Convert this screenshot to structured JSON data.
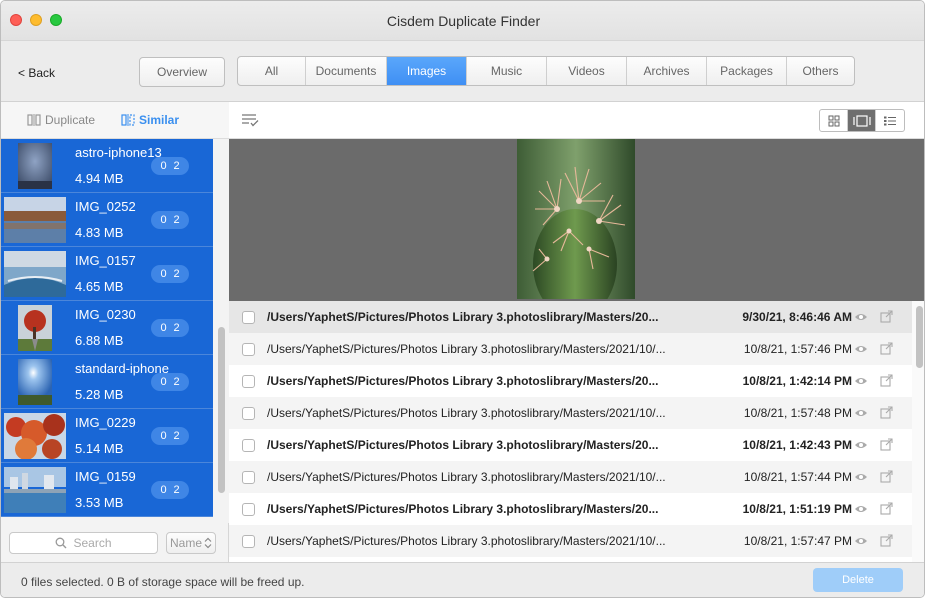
{
  "window": {
    "title": "Cisdem Duplicate Finder"
  },
  "toolbar": {
    "back_label": "< Back",
    "overview_label": "Overview",
    "tabs": [
      {
        "label": "All"
      },
      {
        "label": "Documents"
      },
      {
        "label": "Images",
        "active": true
      },
      {
        "label": "Music"
      },
      {
        "label": "Videos"
      },
      {
        "label": "Archives"
      },
      {
        "label": "Packages"
      },
      {
        "label": "Others"
      }
    ]
  },
  "sidebar": {
    "modes": {
      "duplicate": "Duplicate",
      "similar": "Similar",
      "active": "Similar"
    },
    "items": [
      {
        "name": "astro-iphone13",
        "size": "4.94 MB",
        "badge_left": "0",
        "badge_right": "2"
      },
      {
        "name": "IMG_0252",
        "size": "4.83 MB",
        "badge_left": "0",
        "badge_right": "2"
      },
      {
        "name": "IMG_0157",
        "size": "4.65 MB",
        "badge_left": "0",
        "badge_right": "2"
      },
      {
        "name": "IMG_0230",
        "size": "6.88 MB",
        "badge_left": "0",
        "badge_right": "2"
      },
      {
        "name": "standard-iphone",
        "size": "5.28 MB",
        "badge_left": "0",
        "badge_right": "2"
      },
      {
        "name": "IMG_0229",
        "size": "5.14 MB",
        "badge_left": "0",
        "badge_right": "2"
      },
      {
        "name": "IMG_0159",
        "size": "3.53 MB",
        "badge_left": "0",
        "badge_right": "2"
      }
    ],
    "search_placeholder": "Search",
    "sort_label": "Name"
  },
  "files": {
    "rows": [
      {
        "path": "/Users/YaphetS/Pictures/Photos Library 3.photoslibrary/Masters/20...",
        "date": "9/30/21, 8:46:46 AM",
        "bold": true
      },
      {
        "path": "/Users/YaphetS/Pictures/Photos Library 3.photoslibrary/Masters/2021/10/...",
        "date": "10/8/21, 1:57:46 PM",
        "bold": false
      },
      {
        "path": "/Users/YaphetS/Pictures/Photos Library 3.photoslibrary/Masters/20...",
        "date": "10/8/21, 1:42:14 PM",
        "bold": true
      },
      {
        "path": "/Users/YaphetS/Pictures/Photos Library 3.photoslibrary/Masters/2021/10/...",
        "date": "10/8/21, 1:57:48 PM",
        "bold": false
      },
      {
        "path": "/Users/YaphetS/Pictures/Photos Library 3.photoslibrary/Masters/20...",
        "date": "10/8/21, 1:42:43 PM",
        "bold": true
      },
      {
        "path": "/Users/YaphetS/Pictures/Photos Library 3.photoslibrary/Masters/2021/10/...",
        "date": "10/8/21, 1:57:44 PM",
        "bold": false
      },
      {
        "path": "/Users/YaphetS/Pictures/Photos Library 3.photoslibrary/Masters/20...",
        "date": "10/8/21, 1:51:19 PM",
        "bold": true
      },
      {
        "path": "/Users/YaphetS/Pictures/Photos Library 3.photoslibrary/Masters/2021/10/...",
        "date": "10/8/21, 1:57:47 PM",
        "bold": false
      }
    ]
  },
  "status": {
    "text": "0 files selected. 0 B of storage space will be freed up.",
    "delete_label": "Delete"
  },
  "colors": {
    "accent": "#3f8ff4",
    "selected_item": "#1967d6",
    "delete_disabled": "#9fcdf9"
  }
}
